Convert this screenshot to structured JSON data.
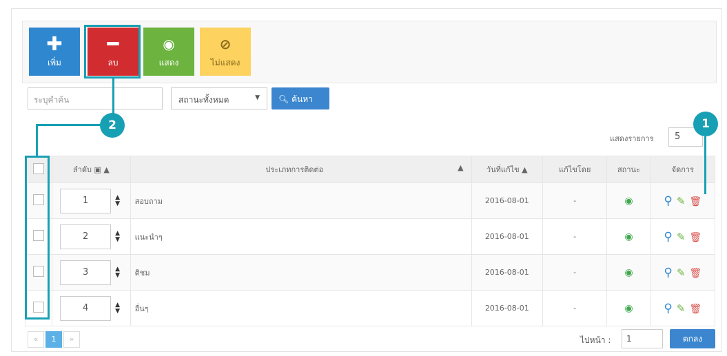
{
  "toolbar": {
    "add": {
      "icon": "plus-icon",
      "glyph": "✚",
      "label": "เพิ่ม",
      "color": "#2f87d0"
    },
    "delete": {
      "icon": "minus-icon",
      "glyph": "━",
      "label": "ลบ",
      "color": "#d12c2f"
    },
    "show": {
      "icon": "eye-icon",
      "glyph": "◉",
      "label": "แสดง",
      "color": "#6cb33f"
    },
    "hide": {
      "icon": "eye-slash-icon",
      "glyph": "⊘",
      "label": "ไม่แสดง",
      "color": "#fdd25f"
    }
  },
  "search": {
    "placeholder": "ระบุคำค้น",
    "status_value": "สถานะทั้งหมด",
    "button_label": "ค้นหา",
    "button_icon": "search-icon"
  },
  "perpage": {
    "label": "แสดงรายการ",
    "value": "5"
  },
  "table": {
    "headers": {
      "order": "ลำดับ",
      "type": "ประเภทการติดต่อ",
      "date": "วันที่แก้ไข",
      "editor": "แก้ไขโดย",
      "status": "สถานะ",
      "actions": "จัดการ"
    },
    "rows": [
      {
        "order": "1",
        "type": "สอบถาม",
        "date": "2016-08-01",
        "editor": "-"
      },
      {
        "order": "2",
        "type": "แนะนำๆ",
        "date": "2016-08-01",
        "editor": "-"
      },
      {
        "order": "3",
        "type": "ติชม",
        "date": "2016-08-01",
        "editor": "-"
      },
      {
        "order": "4",
        "type": "อื่นๆ",
        "date": "2016-08-01",
        "editor": "-"
      }
    ]
  },
  "callouts": {
    "one": "1",
    "two": "2"
  },
  "pager": {
    "prev": "«",
    "current": "1",
    "next": "»"
  },
  "goto": {
    "label": "ไปหน้า :",
    "value": "1",
    "button": "ตกลง"
  },
  "colors": {
    "accent": "#17a0b4",
    "primary": "#3b86cf"
  }
}
